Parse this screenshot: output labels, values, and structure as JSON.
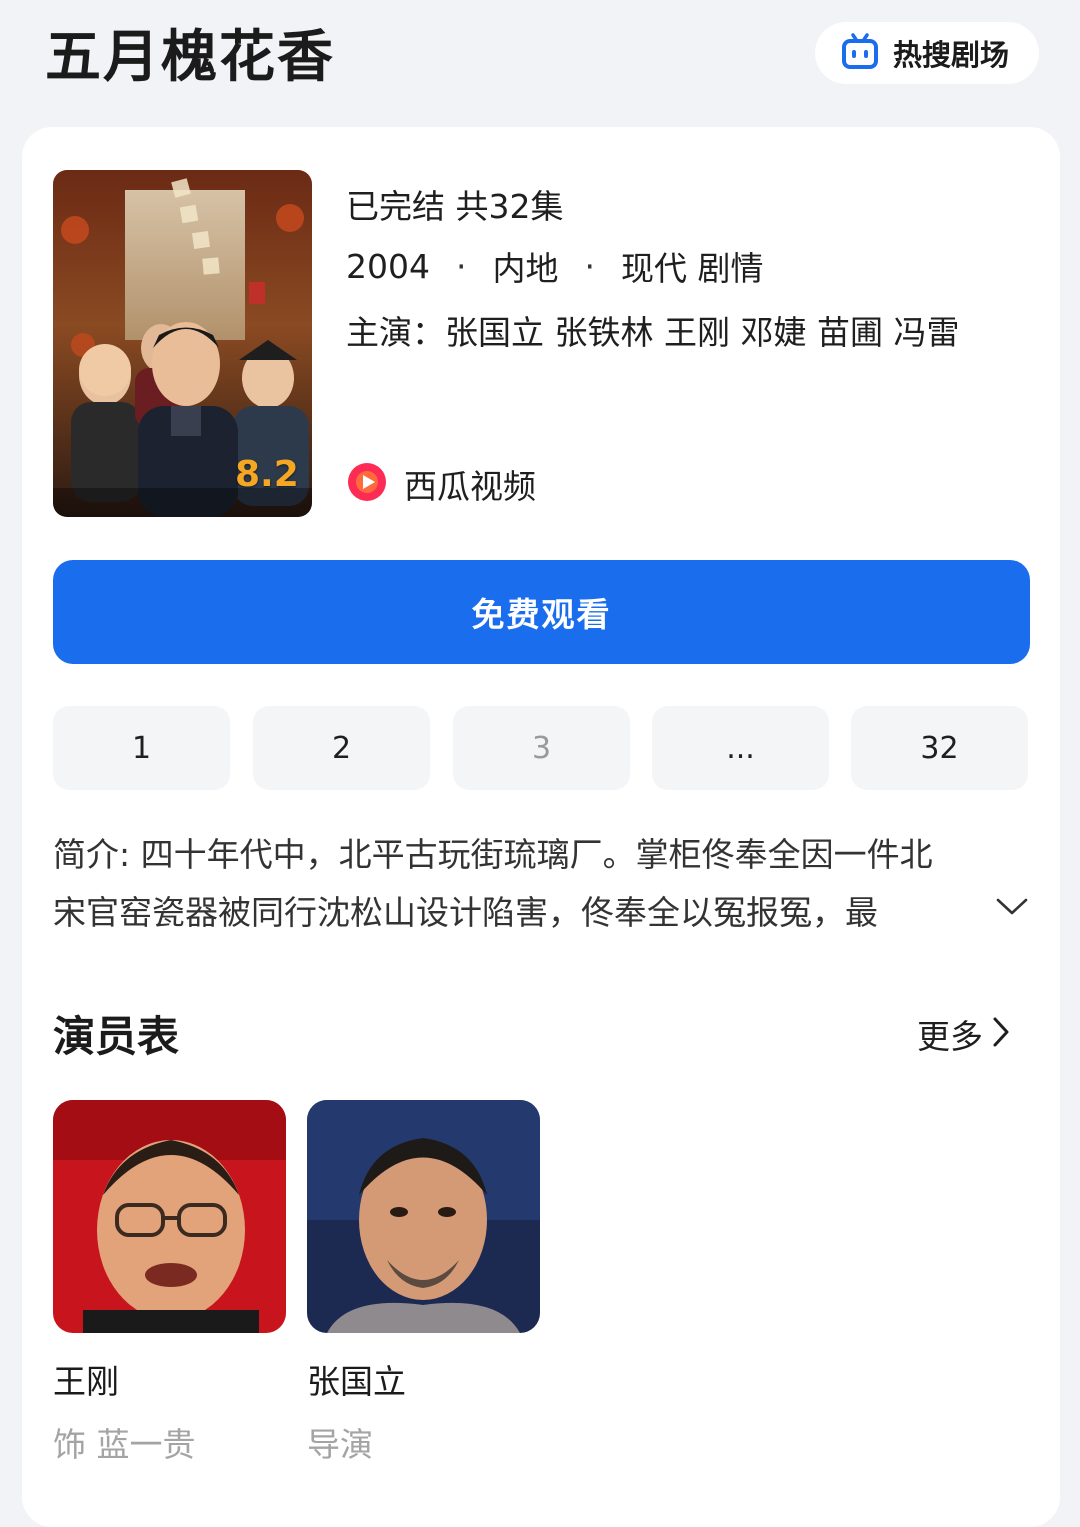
{
  "header": {
    "title": "五月槐花香",
    "hot_label": "热搜剧场"
  },
  "show": {
    "status": "已完结 共32集",
    "year": "2004",
    "region": "内地",
    "genre": "现代 剧情",
    "cast_line": "主演：张国立 张铁林 王刚 邓婕 苗圃 冯雷",
    "rating": "8.2",
    "platform": "西瓜视频",
    "platform_color": "#fe2c55"
  },
  "watch_button": "免费观看",
  "accent_color": "#1a6ded",
  "episodes": [
    "1",
    "2",
    "3",
    "...",
    "32"
  ],
  "synopsis": {
    "line1": "简介: 四十年代中，北平古玩街琉璃厂。掌柜佟奉全因一件北",
    "line2": "宋官窑瓷器被同行沈松山设计陷害，佟奉全以冤报冤，最"
  },
  "cast_section": {
    "title": "演员表",
    "more_label": "更多",
    "members": [
      {
        "name": "王刚",
        "role": "饰 蓝一贵"
      },
      {
        "name": "张国立",
        "role": "导演"
      }
    ]
  }
}
